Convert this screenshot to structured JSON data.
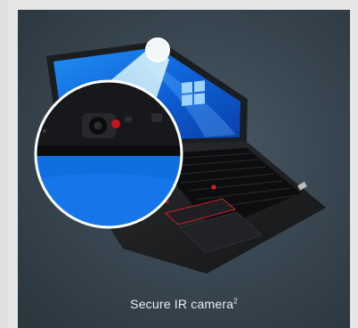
{
  "caption": {
    "text": "Secure IR camera",
    "footnote": "2"
  },
  "icons": {
    "os_logo": "windows-logo-icon",
    "brand_logo": "thinkpad-logo-icon"
  },
  "colors": {
    "screen_blue": "#0f6fe0",
    "trackpoint_red": "#d41e2a",
    "card_bg": "#3a4853"
  }
}
